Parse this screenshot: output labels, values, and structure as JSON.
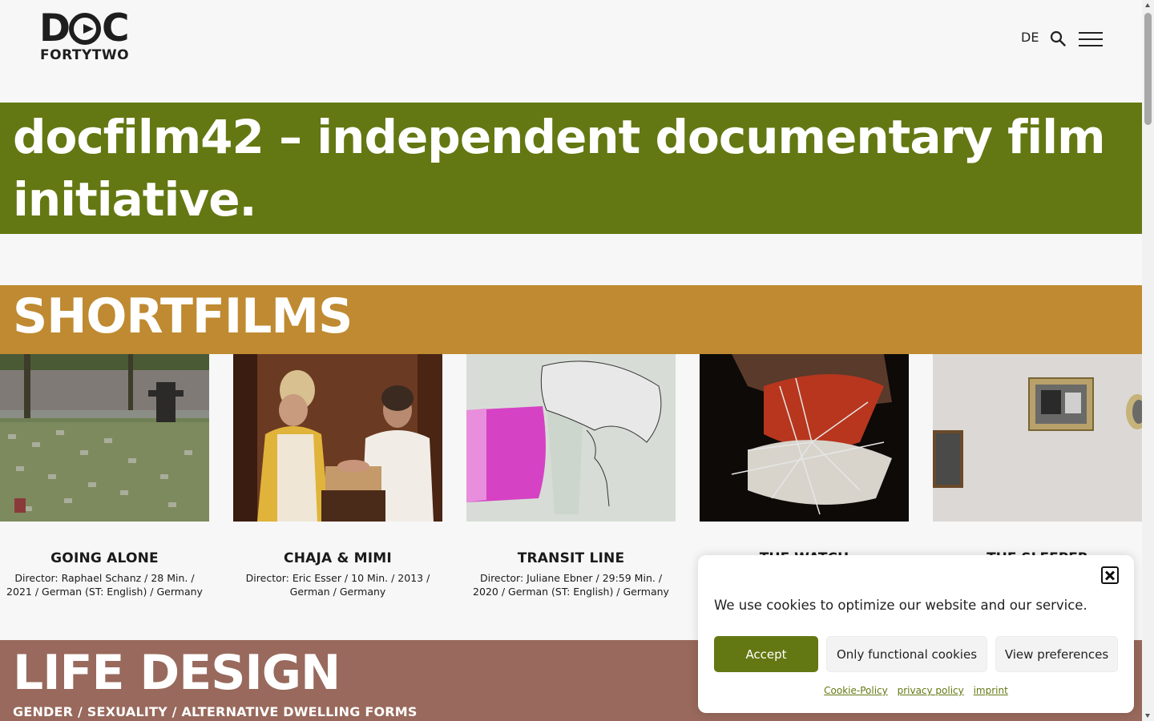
{
  "header": {
    "logo_top": "DOC",
    "logo_bottom": "FORTYTWO",
    "lang": "DE"
  },
  "hero": {
    "title": "docfilm42 – independent documentary film initiative."
  },
  "shortfilms": {
    "heading": "SHORTFILMS",
    "films": [
      {
        "title": "GOING ALONE",
        "meta": "Director: Raphael Schanz / 28 Min. / 2021 / German (ST: English) / Germany"
      },
      {
        "title": "CHAJA & MIMI",
        "meta": "Director: Eric Esser / 10 Min. / 2013 / German / Germany"
      },
      {
        "title": "TRANSIT LINE",
        "meta": "Director: Juliane Ebner / 29:59 Min. / 2020 / German (ST: English) / Germany"
      },
      {
        "title": "THE WATCH",
        "meta": ""
      },
      {
        "title": "THE SLEEPER",
        "meta": ""
      }
    ]
  },
  "life": {
    "heading": "LIFE DESIGN",
    "subheading": "GENDER / SEXUALITY / ALTERNATIVE DWELLING FORMS"
  },
  "cookie": {
    "message": "We use cookies to optimize our website and our service.",
    "accept": "Accept",
    "functional": "Only functional cookies",
    "preferences": "View preferences",
    "links": [
      "Cookie-Policy",
      "privacy policy",
      "imprint"
    ]
  },
  "colors": {
    "hero_green": "#637812",
    "shortfilms_ochre": "#bf8a31",
    "life_brown": "#98695c"
  }
}
